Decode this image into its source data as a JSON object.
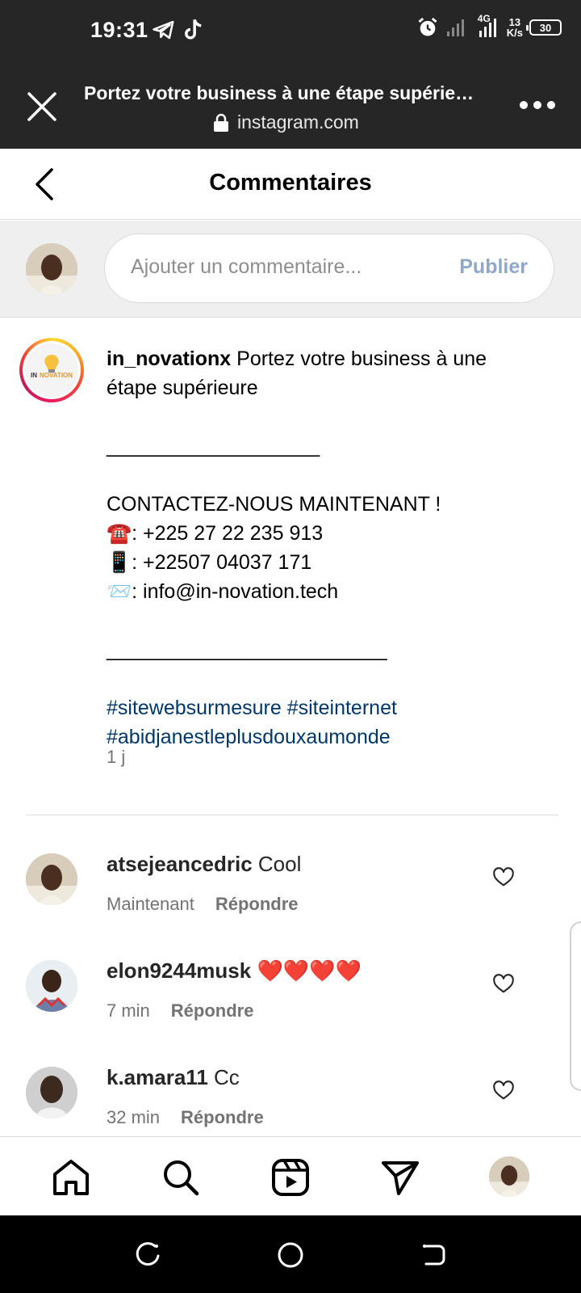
{
  "status_bar": {
    "time": "19:31",
    "network": "4G",
    "speed_value": "13",
    "speed_unit": "K/s",
    "battery": "30"
  },
  "browser": {
    "title": "Portez votre business à une étape supérie…",
    "url": "instagram.com"
  },
  "header": {
    "title": "Commentaires"
  },
  "composer": {
    "placeholder": "Ajouter un commentaire...",
    "publish_label": "Publier"
  },
  "post": {
    "logo_text_1": "IN",
    "logo_text_2": "NOVATION",
    "username": "in_novationx",
    "caption_line_1": "Portez votre business à une",
    "caption_line_2": "étape supérieure",
    "separator_1": "___________________",
    "contact_heading": "CONTACTEZ-NOUS MAINTENANT !",
    "phone_1": "☎️: +225 27 22 235 913",
    "phone_2": "📱: +22507 04037 171",
    "email": "📨: info@in-novation.tech",
    "separator_2": "_________________________",
    "hashtag_1": "#sitewebsurmesure",
    "hashtag_2": "#siteinternet",
    "hashtag_3": "#abidjanestleplusdouxaumonde",
    "time": "1 j"
  },
  "comments": [
    {
      "username": "atsejeancedric",
      "text": "Cool",
      "time": "Maintenant",
      "reply_label": "Répondre"
    },
    {
      "username": "elon9244musk",
      "text": "❤️❤️❤️❤️",
      "time": "7 min",
      "reply_label": "Répondre"
    },
    {
      "username": "k.amara11",
      "text": "Cc",
      "time": "32 min",
      "reply_label": "Répondre"
    }
  ],
  "colors": {
    "status_bg": "#262626",
    "hashtag": "#00376b",
    "publish_disabled": "#8fa8c8",
    "secondary_text": "#737373"
  },
  "icons": {
    "status": [
      "telegram-icon",
      "tiktok-icon",
      "alarm-icon",
      "signal-icon",
      "battery-icon"
    ],
    "browser": [
      "close-icon",
      "lock-icon",
      "more-icon"
    ],
    "nav": [
      "home-icon",
      "search-icon",
      "reels-icon",
      "direct-icon",
      "profile-avatar"
    ],
    "system": [
      "recents-icon",
      "home-circle-icon",
      "back-icon"
    ]
  }
}
